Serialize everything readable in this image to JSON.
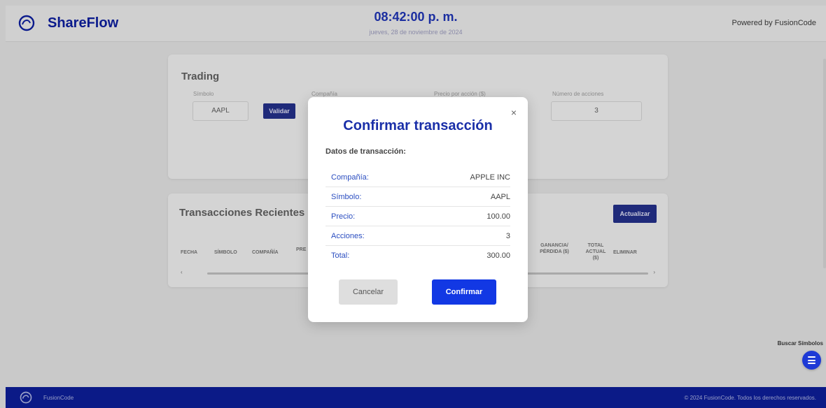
{
  "header": {
    "brand": "ShareFlow",
    "time": "08:42:00 p. m.",
    "date": "jueves, 28 de noviembre de 2024",
    "powered_by": "Powered by FusionCode"
  },
  "trading": {
    "title": "Trading",
    "symbol_label": "Símbolo",
    "symbol_value": "AAPL",
    "validate_label": "Validar",
    "company_label": "Compañía",
    "price_label": "Precio por acción ($)",
    "shares_label": "Número de acciones",
    "shares_value": "3"
  },
  "transactions": {
    "title": "Transacciones Recientes",
    "refresh_label": "Actualizar",
    "columns": [
      "FECHA",
      "SÍMBOLO",
      "COMPAÑÍA",
      "PRE",
      "GANANCIA/ PÉRDIDA ($)",
      "TOTAL ACTUAL ($)",
      "ELIMINAR"
    ],
    "scroll_left": "‹",
    "scroll_right": "›"
  },
  "search_symbols": {
    "label": "Buscar Símbolos",
    "icon": "menu-icon"
  },
  "footer": {
    "brand": "FusionCode",
    "copyright": "© 2024 FusionCode. Todos los derechos reservados."
  },
  "modal": {
    "close": "×",
    "title": "Confirmar transacción",
    "subtitle": "Datos de transacción:",
    "rows": [
      {
        "label": "Compañía:",
        "value": "APPLE INC"
      },
      {
        "label": "Símbolo:",
        "value": "AAPL"
      },
      {
        "label": "Precio:",
        "value": "100.00"
      },
      {
        "label": "Acciones:",
        "value": "3"
      },
      {
        "label": "Total:",
        "value": "300.00"
      }
    ],
    "cancel_label": "Cancelar",
    "confirm_label": "Confirmar"
  },
  "colors": {
    "brand": "#0a1a8c",
    "accent": "#1238e4",
    "footer_bg": "#0b1a87"
  }
}
